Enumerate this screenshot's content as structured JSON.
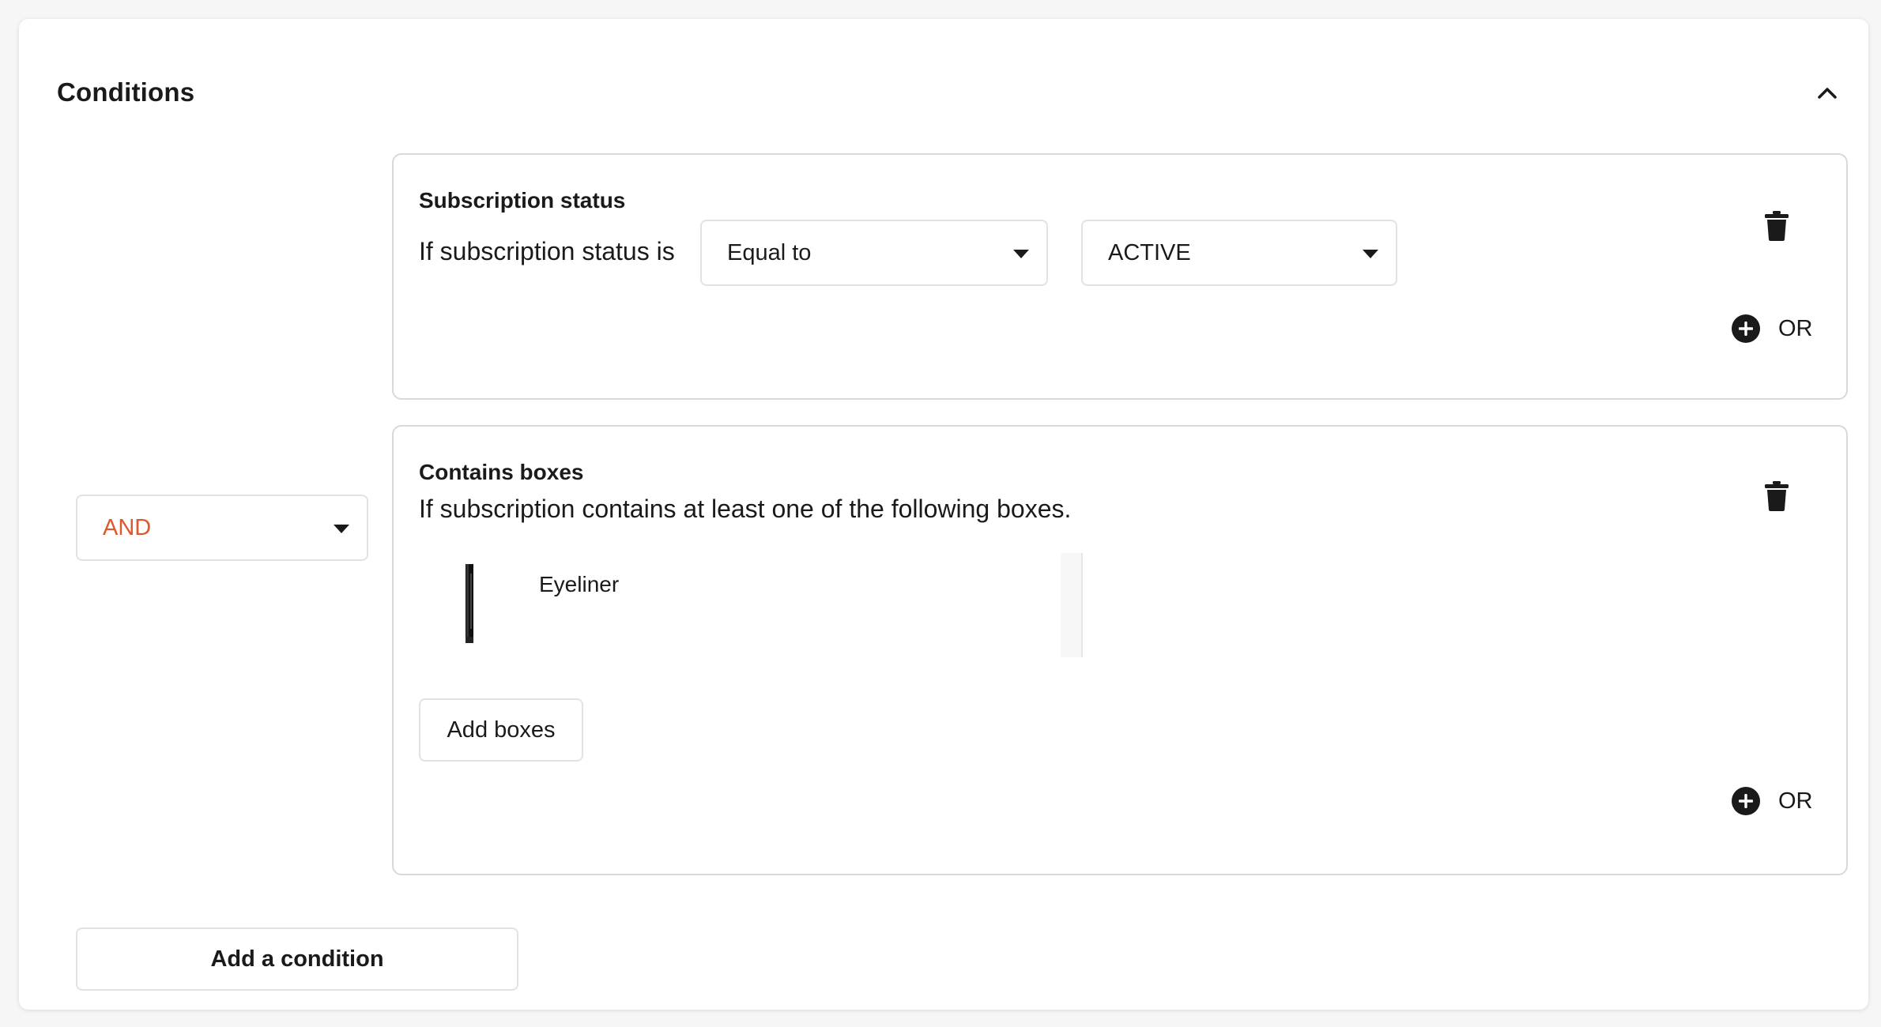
{
  "card": {
    "title": "Conditions",
    "collapse_icon": "chevron-up-icon"
  },
  "logic_operator": {
    "value": "AND",
    "color": "#e0572e"
  },
  "conditions": [
    {
      "label": "Subscription status",
      "text": "If subscription status is",
      "operator_select": {
        "value": "Equal to"
      },
      "status_select": {
        "value": "ACTIVE"
      },
      "delete_icon": "trash-icon",
      "or_icon": "plus-circle-icon",
      "or_label": "OR"
    },
    {
      "label": "Contains boxes",
      "text": "If subscription contains at least one of the following boxes.",
      "boxes": [
        {
          "name": "Eyeliner",
          "thumbnail_icon": "eyeliner-thumbnail"
        }
      ],
      "add_boxes_label": "Add boxes",
      "delete_icon": "trash-icon",
      "or_icon": "plus-circle-icon",
      "or_label": "OR"
    }
  ],
  "add_condition_label": "Add a condition"
}
